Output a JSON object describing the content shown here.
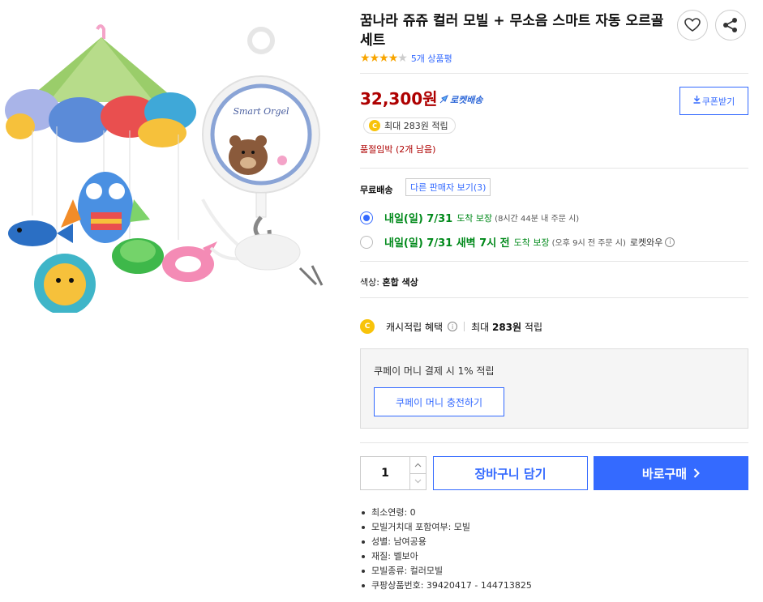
{
  "product": {
    "title": "꿈나라 쥬쥬 컬러 모빌 + 무소음 스마트 자동 오르골 세트",
    "image_brand_text": "Smart Orgel",
    "rating_stars": 4,
    "rating_max": 5,
    "review_count_label": "5개 상품평"
  },
  "price": {
    "amount": "32,300원",
    "rocket_label": "로켓배송",
    "coupon_button": "쿠폰받기",
    "points_label": "최대 283원 적립",
    "stock_warning": "품절임박 (2개 남음)"
  },
  "shipping": {
    "label": "무료배송",
    "other_sellers": "다른 판매자 보기(3)",
    "options": [
      {
        "date": "내일(일) 7/31",
        "guarantee": "도착 보장",
        "note": "(8시간 44분 내 주문 시)",
        "suffix": "",
        "selected": true
      },
      {
        "date": "내일(일) 7/31 새벽 7시 전",
        "guarantee": "도착 보장",
        "note": "(오후 9시 전 주문 시)",
        "suffix": "로켓와우",
        "selected": false
      }
    ]
  },
  "option": {
    "label": "색상:",
    "value": "혼합 색상"
  },
  "cash": {
    "label": "캐시적립 혜택",
    "max_prefix": "최대",
    "max_amount": "283원",
    "max_suffix": "적립",
    "coupay_text": "쿠페이 머니 결제 시 1% 적립",
    "coupay_button": "쿠페이 머니 충전하기"
  },
  "purchase": {
    "quantity": "1",
    "cart_button": "장바구니 담기",
    "buy_button": "바로구매"
  },
  "attributes": [
    "최소연령: 0",
    "모빌거치대 포함여부: 모빌",
    "성별: 남여공용",
    "재질: 벨보아",
    "모빌종류: 컬러모빌",
    "쿠팡상품번호: 39420417 - 144713825"
  ],
  "colors": {
    "accent": "#346aff",
    "price": "#ae0000",
    "delivery": "#00891a",
    "star": "#f8a500",
    "coin": "#f8c30a"
  }
}
